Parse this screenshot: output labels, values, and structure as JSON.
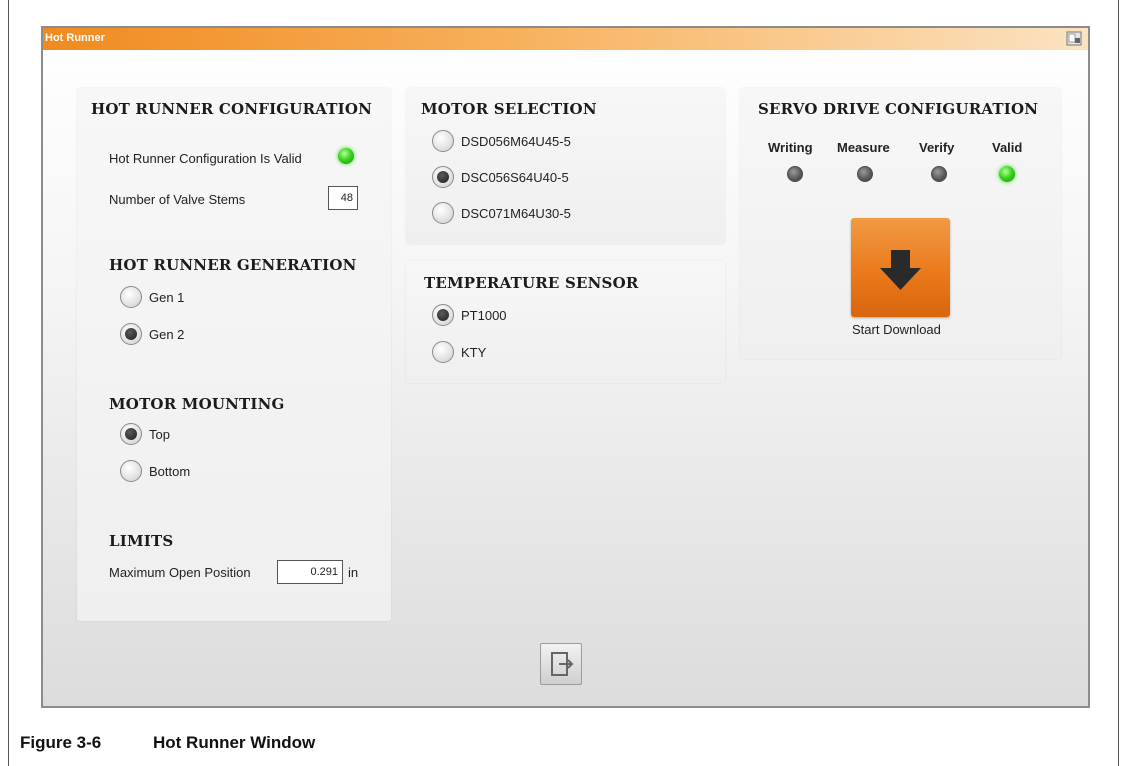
{
  "window": {
    "title": "Hot Runner",
    "title_icon": "window-options-icon",
    "accent_color": "#f08a20"
  },
  "hot_runner_config": {
    "heading": "HOT RUNNER CONFIGURATION",
    "valid_label": "Hot Runner Configuration Is Valid",
    "valid_state": "on",
    "valve_stems_label": "Number of Valve Stems",
    "valve_stems_value": "48"
  },
  "generation": {
    "heading": "HOT RUNNER GENERATION",
    "options": [
      {
        "label": "Gen 1",
        "selected": false
      },
      {
        "label": "Gen 2",
        "selected": true
      }
    ]
  },
  "mounting": {
    "heading": "MOTOR MOUNTING",
    "options": [
      {
        "label": "Top",
        "selected": true
      },
      {
        "label": "Bottom",
        "selected": false
      }
    ]
  },
  "limits": {
    "heading": "LIMITS",
    "max_open_label": "Maximum Open Position",
    "max_open_value": "0.291",
    "max_open_unit": "in"
  },
  "motor_selection": {
    "heading": "MOTOR SELECTION",
    "options": [
      {
        "label": "DSD056M64U45-5",
        "selected": false
      },
      {
        "label": "DSC056S64U40-5",
        "selected": true
      },
      {
        "label": "DSC071M64U30-5",
        "selected": false
      }
    ]
  },
  "temperature_sensor": {
    "heading": "TEMPERATURE SENSOR",
    "options": [
      {
        "label": "PT1000",
        "selected": true
      },
      {
        "label": "KTY",
        "selected": false
      }
    ]
  },
  "servo": {
    "heading": "SERVO DRIVE CONFIGURATION",
    "indicators": [
      {
        "label": "Writing",
        "state": "off"
      },
      {
        "label": "Measure",
        "state": "off"
      },
      {
        "label": "Verify",
        "state": "off"
      },
      {
        "label": "Valid",
        "state": "on"
      }
    ],
    "download_label": "Start Download",
    "download_icon": "arrow-down-icon"
  },
  "footer": {
    "exit_icon": "exit-door-icon"
  },
  "caption": {
    "number": "Figure 3-6",
    "title": "Hot Runner Window"
  }
}
